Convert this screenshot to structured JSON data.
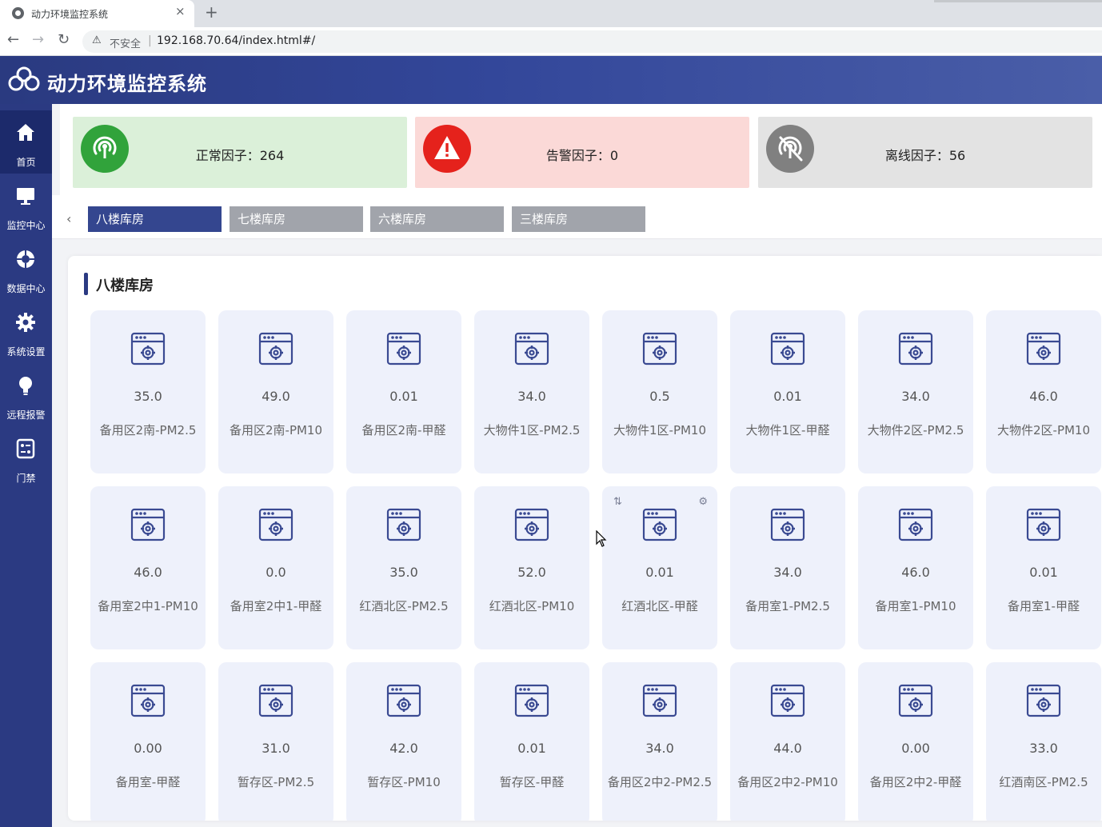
{
  "browser": {
    "tab_title": "动力环境监控系统",
    "tab_close": "×",
    "new_tab": "+",
    "security_label": "不安全",
    "separator": "|",
    "url": "192.168.70.64/index.html#/",
    "nav": {
      "back": "←",
      "forward": "→",
      "reload": "↻"
    },
    "warn_icon": "⚠"
  },
  "app": {
    "title": "动力环境监控系统"
  },
  "sidebar": {
    "items": [
      {
        "label": "首页",
        "icon": "home-icon",
        "active": true
      },
      {
        "label": "监控中心",
        "icon": "monitor-icon"
      },
      {
        "label": "数据中心",
        "icon": "lifebuoy-icon"
      },
      {
        "label": "系统设置",
        "icon": "gear-icon"
      },
      {
        "label": "远程报警",
        "icon": "bulb-icon"
      },
      {
        "label": "门禁",
        "icon": "panel-icon"
      }
    ]
  },
  "status": {
    "normal": {
      "label": "正常因子：264",
      "color": "#dbf0d9",
      "icon_color": "#31a33b"
    },
    "alarm": {
      "label": "告警因子：0",
      "color": "#fbd9d7",
      "icon_color": "#e5221c"
    },
    "offline": {
      "label": "离线因子：56",
      "color": "#e3e3e3",
      "icon_color": "#808080"
    }
  },
  "area_tabs": {
    "arrow": "‹",
    "items": [
      {
        "label": "八楼库房",
        "active": true
      },
      {
        "label": "七楼库房"
      },
      {
        "label": "六楼库房"
      },
      {
        "label": "三楼库房"
      }
    ],
    "active_color": "#34468f",
    "inactive_color": "#a1a4ab"
  },
  "panel": {
    "title": "八楼库房",
    "hover_swap_icon": "⇅",
    "hover_gear_icon": "⚙",
    "cards": [
      {
        "value": "35.0",
        "label": "备用区2南-PM2.5"
      },
      {
        "value": "49.0",
        "label": "备用区2南-PM10"
      },
      {
        "value": "0.01",
        "label": "备用区2南-甲醛"
      },
      {
        "value": "34.0",
        "label": "大物件1区-PM2.5"
      },
      {
        "value": "0.5",
        "label": "大物件1区-PM10"
      },
      {
        "value": "0.01",
        "label": "大物件1区-甲醛"
      },
      {
        "value": "34.0",
        "label": "大物件2区-PM2.5"
      },
      {
        "value": "46.0",
        "label": "大物件2区-PM10"
      },
      {
        "value": "46.0",
        "label": "备用室2中1-PM10"
      },
      {
        "value": "0.0",
        "label": "备用室2中1-甲醛"
      },
      {
        "value": "35.0",
        "label": "红酒北区-PM2.5"
      },
      {
        "value": "52.0",
        "label": "红酒北区-PM10"
      },
      {
        "value": "0.01",
        "label": "红酒北区-甲醛",
        "hovered": true
      },
      {
        "value": "34.0",
        "label": "备用室1-PM2.5"
      },
      {
        "value": "46.0",
        "label": "备用室1-PM10"
      },
      {
        "value": "0.01",
        "label": "备用室1-甲醛"
      },
      {
        "value": "0.00",
        "label": "备用室-甲醛"
      },
      {
        "value": "31.0",
        "label": "暂存区-PM2.5"
      },
      {
        "value": "42.0",
        "label": "暂存区-PM10"
      },
      {
        "value": "0.01",
        "label": "暂存区-甲醛"
      },
      {
        "value": "34.0",
        "label": "备用区2中2-PM2.5"
      },
      {
        "value": "44.0",
        "label": "备用区2中2-PM10"
      },
      {
        "value": "0.00",
        "label": "备用区2中2-甲醛"
      },
      {
        "value": "33.0",
        "label": "红酒南区-PM2.5"
      }
    ]
  }
}
